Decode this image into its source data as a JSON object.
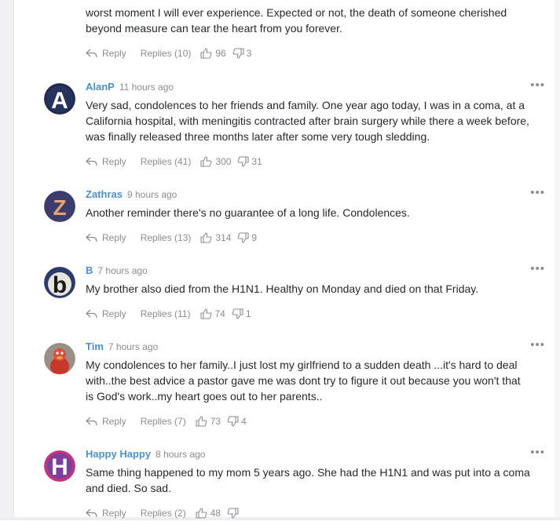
{
  "common": {
    "reply_label": "Reply"
  },
  "top_comment": {
    "lines": [
      "worst moment I will ever experience. Expected or not, the death of someone cherished",
      "beyond measure can tear the heart from you forever."
    ],
    "replies": "Replies (10)",
    "likes": "96",
    "dislikes": "3"
  },
  "comments": [
    {
      "author": "AlanP",
      "time": "11 hours ago",
      "menu": "•••",
      "lines": [
        "Very sad, condolences to her friends and family. One year ago today, I was in a coma, at a",
        "California hospital, with meningitis contracted after brain surgery while there a week before,",
        "was finally released three months later after some very tough sledding."
      ],
      "replies": "Replies (41)",
      "likes": "300",
      "dislikes": "31"
    },
    {
      "author": "Zathras",
      "time": "9 hours ago",
      "menu": "•••",
      "lines": [
        "Another reminder there's no guarantee of a long life. Condolences."
      ],
      "replies": "Replies (13)",
      "likes": "314",
      "dislikes": "9"
    },
    {
      "author": "B",
      "time": "7 hours ago",
      "menu": "•••",
      "lines": [
        "My brother also died from the H1N1. Healthy on Monday and died on that Friday."
      ],
      "replies": "Replies (11)",
      "likes": "74",
      "dislikes": "1"
    },
    {
      "author": "Tim",
      "time": "7 hours ago",
      "menu": "•••",
      "lines": [
        "My condolences to her family..I just lost my girlfriend to a sudden death ...it's hard to deal",
        "with..the best advice a pastor gave me was dont try to figure it out because you won't that",
        "is God's work..my heart goes out to her parents.."
      ],
      "replies": "Replies (7)",
      "likes": "73",
      "dislikes": "4"
    },
    {
      "author": "Happy Happy",
      "time": "8 hours ago",
      "menu": "•••",
      "lines": [
        "Same thing happened to my mom 5 years ago. She had the H1N1 and was put into a coma",
        "and died. So sad."
      ],
      "replies": "Replies (2)",
      "likes": "48",
      "dislikes": ""
    }
  ],
  "avatars": [
    {
      "letter": "A",
      "bg": "#1f2a4d",
      "fg": "#ffffff"
    },
    {
      "letter": "Z",
      "bg": "#3a3d6e",
      "fg": "#e6a36a"
    },
    {
      "letter": "b",
      "bg": "#2b3b6b",
      "fg": "#ffffff"
    },
    {
      "letter": "",
      "bg": "#d94f3a",
      "fg": "#7a1a12"
    },
    {
      "letter": "H",
      "bg": "#c2357a",
      "fg": "#ffffff"
    }
  ],
  "colors": {
    "author": "#4e90ce",
    "muted": "#8c8c90",
    "text": "#26282a"
  }
}
